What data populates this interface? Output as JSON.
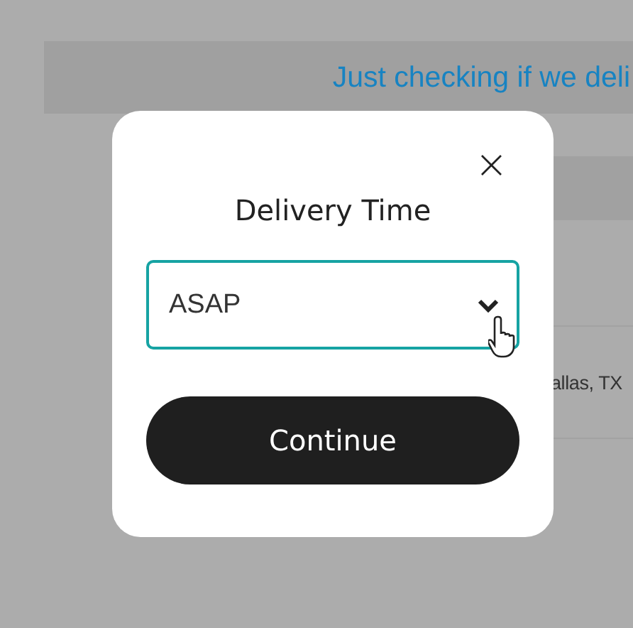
{
  "background_page": {
    "banner": "Just checking if we deli",
    "address": "allas, TX"
  },
  "modal": {
    "close": "×",
    "title": "Delivery Time",
    "select": {
      "value": "ASAP",
      "focused": true
    },
    "button": "Continue"
  }
}
